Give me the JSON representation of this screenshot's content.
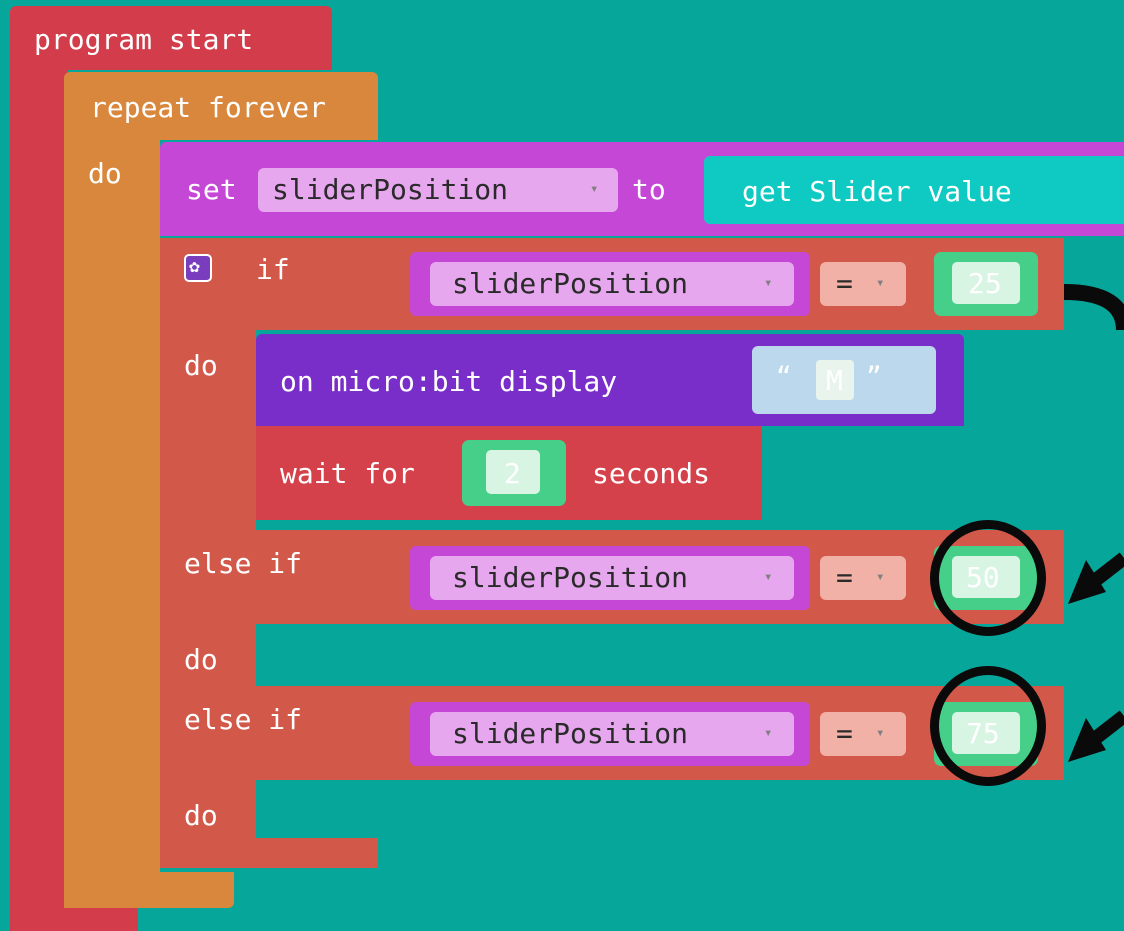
{
  "program": {
    "start_label": "program start"
  },
  "repeat": {
    "label": "repeat forever",
    "do_label": "do"
  },
  "set_block": {
    "set_label": "set",
    "variable": "sliderPosition",
    "to_label": "to",
    "value_block": "get Slider value"
  },
  "if_block": {
    "if_label": "if",
    "else_if_label": "else if",
    "do_label": "do",
    "conditions": [
      {
        "variable": "sliderPosition",
        "operator": "=",
        "value": "25"
      },
      {
        "variable": "sliderPosition",
        "operator": "=",
        "value": "50"
      },
      {
        "variable": "sliderPosition",
        "operator": "=",
        "value": "75"
      }
    ]
  },
  "display_block": {
    "label": "on micro:bit display",
    "open_quote": "“",
    "value": "M",
    "close_quote": "”"
  },
  "wait_block": {
    "label": "wait for",
    "value": "2",
    "unit": "seconds"
  },
  "icons": {
    "dropdown": "▾",
    "gear": "gear-icon"
  },
  "colors": {
    "background": "#07a69a",
    "program_start": "#d33c4a",
    "repeat": "#d8873c",
    "set": "#c547d6",
    "if": "#d2584a",
    "display": "#7a2ec9",
    "number": "#46cf88",
    "slider_value": "#0ecac2"
  }
}
